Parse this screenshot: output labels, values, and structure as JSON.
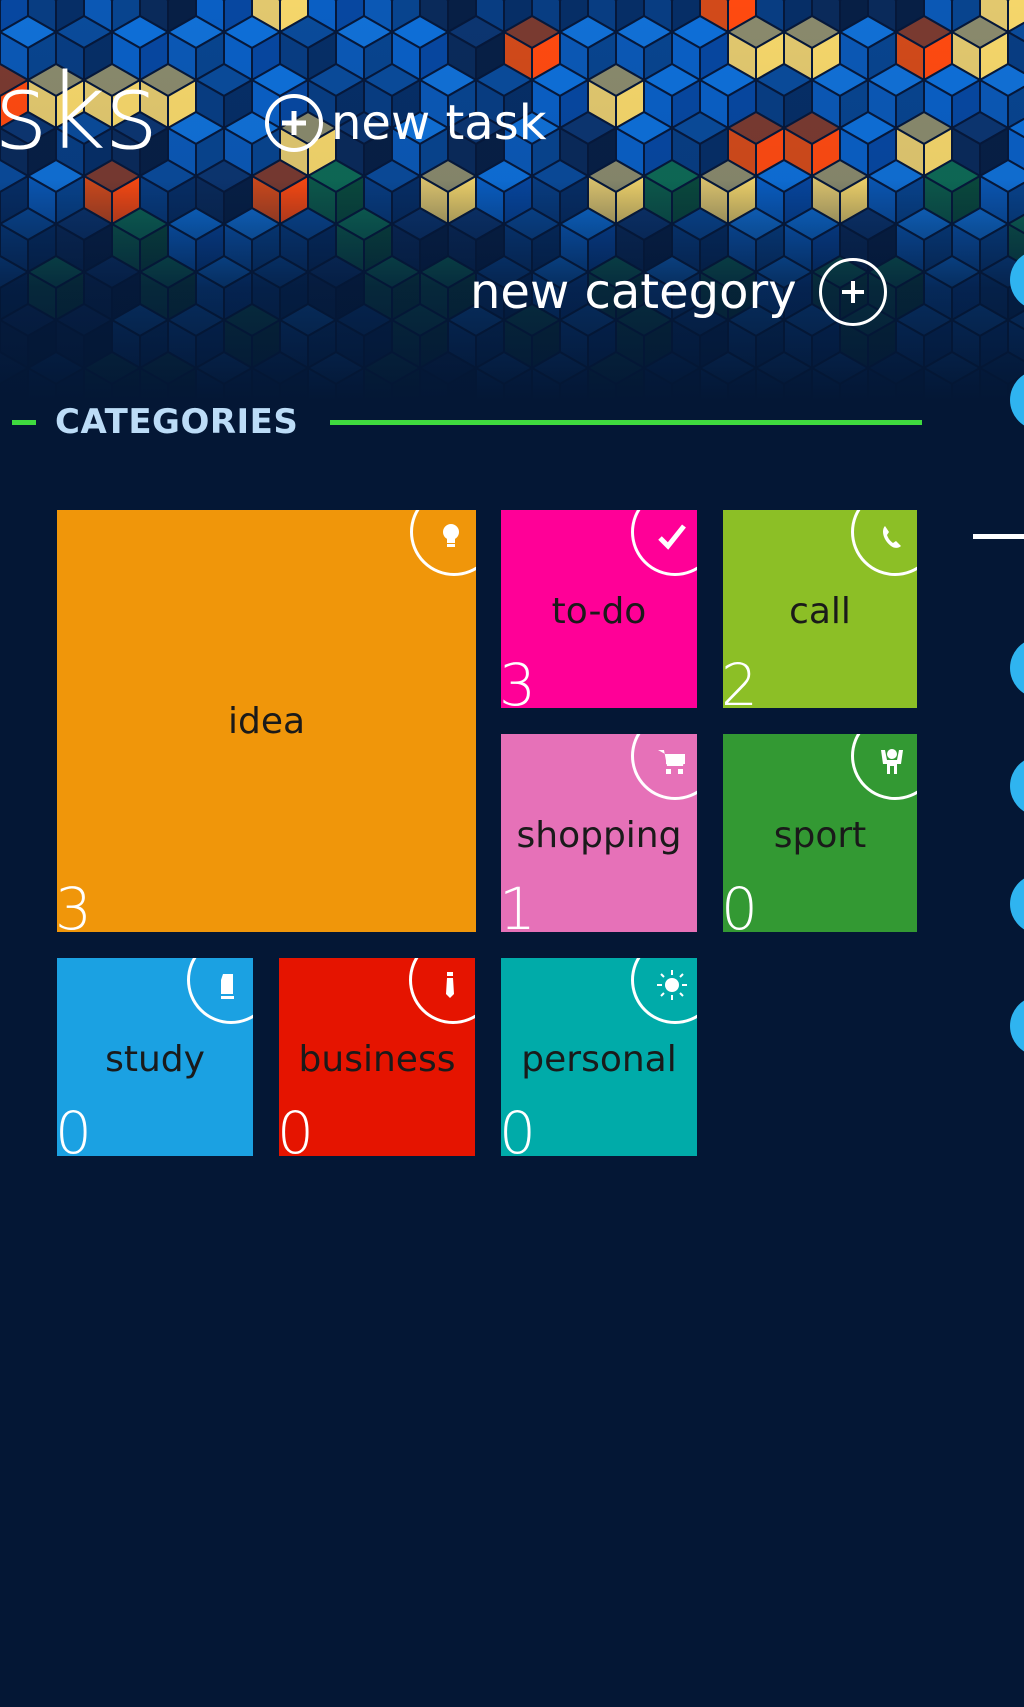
{
  "app": {
    "title_partial": "sks",
    "new_task_label": "new task",
    "new_category_label": "new category"
  },
  "section": {
    "title": "CATEGORIES",
    "accent_color": "#3fda3f"
  },
  "categories": [
    {
      "name": "idea",
      "count": "3",
      "color": "#f0960a",
      "icon": "lightbulb-icon"
    },
    {
      "name": "to-do",
      "count": "3",
      "color": "#ff0097",
      "icon": "checkmark-icon"
    },
    {
      "name": "call",
      "count": "2",
      "color": "#8cbf26",
      "icon": "phone-icon"
    },
    {
      "name": "shopping",
      "count": "1",
      "color": "#e671b8",
      "icon": "shopping-cart-icon"
    },
    {
      "name": "sport",
      "count": "0",
      "color": "#339933",
      "icon": "sport-person-icon"
    },
    {
      "name": "study",
      "count": "0",
      "color": "#1ba1e2",
      "icon": "book-icon"
    },
    {
      "name": "business",
      "count": "0",
      "color": "#e51400",
      "icon": "tie-icon"
    },
    {
      "name": "personal",
      "count": "0",
      "color": "#00aba9",
      "icon": "sun-icon"
    }
  ],
  "colors": {
    "background": "#041735",
    "next_section_dots": "#2fb4f0"
  }
}
